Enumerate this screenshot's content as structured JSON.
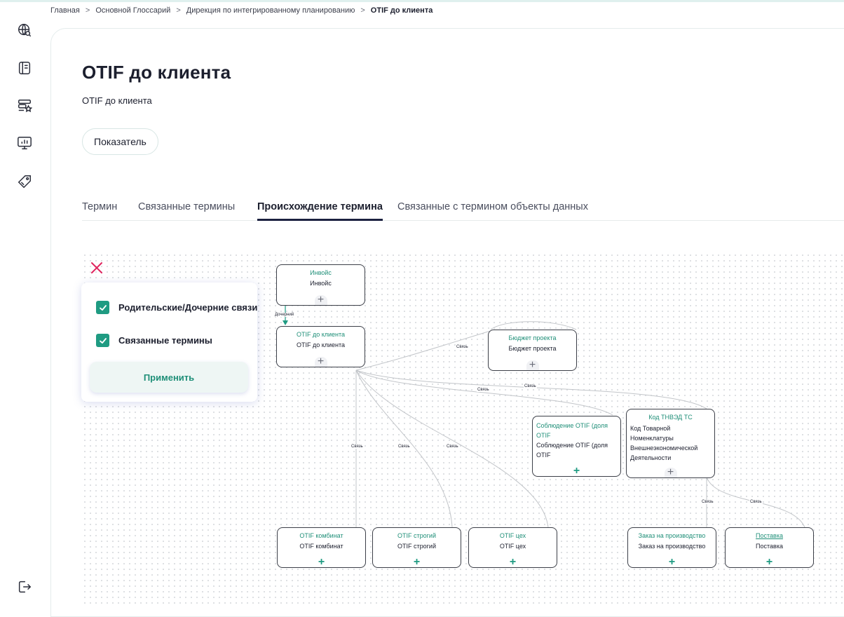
{
  "breadcrumbs": [
    {
      "label": "Главная"
    },
    {
      "label": "Основной Глоссарий"
    },
    {
      "label": "Дирекция по интегрированному планированию"
    },
    {
      "label": "OTIF до клиента"
    }
  ],
  "breadcrumb_separator": ">",
  "sidebar": {
    "icons": [
      "globe-search-icon",
      "book-icon",
      "catalog-star-icon",
      "monitor-chart-icon",
      "tag-icon"
    ],
    "logout_icon": "logout-icon"
  },
  "term": {
    "title": "OTIF до клиента",
    "subtitle": "OTIF до клиента",
    "type": "Показатель"
  },
  "tabs": [
    {
      "label": "Термин"
    },
    {
      "label": "Связанные термины"
    },
    {
      "label": "Происхождение термина",
      "active": true
    },
    {
      "label": "Связанные с термином объекты данных"
    }
  ],
  "filter": {
    "close_icon": "close-icon",
    "options": [
      {
        "label": "Родительские/Дочерние связи",
        "checked": true
      },
      {
        "label": "Связанные термины",
        "checked": true
      }
    ],
    "apply_label": "Применить"
  },
  "graph": {
    "nodes": [
      {
        "id": "invoice",
        "title": "Инвойс",
        "desc": "Инвойс"
      },
      {
        "id": "otif_client",
        "title": "OTIF до клиента",
        "desc": "OTIF до клиента"
      },
      {
        "id": "budget",
        "title": "Бюджет проекта",
        "desc": "Бюджет проекта"
      },
      {
        "id": "otif_share",
        "title": "Соблюдение OTIF (доля OTIF",
        "desc": "Соблюдение OTIF (доля OTIF"
      },
      {
        "id": "tnved",
        "title": "Код ТНВЭД ТС",
        "desc": "Код Товарной Номенклатуры Внешнеэкономической Деятельности"
      },
      {
        "id": "otif_kombinat",
        "title": "OTIF комбинат",
        "desc": "OTIF комбинат"
      },
      {
        "id": "otif_strict",
        "title": "OTIF строгий",
        "desc": "OTIF строгий"
      },
      {
        "id": "otif_shop",
        "title": "OTIF цех",
        "desc": "OTIF цех"
      },
      {
        "id": "prod_order",
        "title": "Заказ на производство",
        "desc": "Заказ на производство"
      },
      {
        "id": "delivery",
        "title": "Поставка",
        "desc": "Поставка"
      }
    ],
    "edge_label_child": "Дочерний",
    "edge_label_link": "Связь",
    "accent_color": "#1f9b82"
  }
}
